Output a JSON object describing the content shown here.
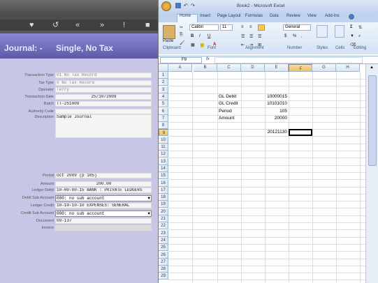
{
  "journal": {
    "header_title": "Journal: -",
    "header_subtitle": "Single, No Tax",
    "fields": [
      {
        "label": "Transaction Type",
        "value": "01 No Tax Record",
        "style": "grey"
      },
      {
        "label": "Tax Type",
        "value": "0 No Tax Record",
        "style": "grey"
      },
      {
        "label": "Operator",
        "value": "Terry",
        "style": "grey"
      },
      {
        "label": "Transaction Date",
        "value": "25/10/2009",
        "style": "normal"
      },
      {
        "label": "Batch",
        "value": "TT-251009",
        "style": "normal"
      },
      {
        "label": "Authority Code",
        "value": "",
        "style": "normal"
      },
      {
        "label": "Description",
        "value": "Sample Journal",
        "style": "normal"
      },
      {
        "label": "Period",
        "value": "Oct 2009 (p 105)",
        "style": "normal"
      },
      {
        "label": "Amount",
        "value": "200.00",
        "style": "normal"
      },
      {
        "label": "Ledger Debit",
        "value": "10-00-00-15 BANK : PRIVATE LEDGERS",
        "style": "normal"
      },
      {
        "label": "Debit Sub Account",
        "value": "000: no sub account",
        "style": "select"
      },
      {
        "label": "Ledger Credit",
        "value": "10-10-10-10 EXPENSES: GENERAL",
        "style": "normal"
      },
      {
        "label": "Credit Sub Account",
        "value": "000: no sub account",
        "style": "select"
      },
      {
        "label": "Document",
        "value": "09-137",
        "style": "normal"
      },
      {
        "label": "Invoice",
        "value": "",
        "style": "blank"
      }
    ]
  },
  "excel": {
    "title": "Book2 - Microsoft Excel",
    "tabs": [
      "Home",
      "Insert",
      "Page Layout",
      "Formulas",
      "Data",
      "Review",
      "View",
      "Add-Ins"
    ],
    "groups": [
      "Clipboard",
      "Font",
      "Alignment",
      "Number",
      "Styles",
      "Cells",
      "Editing"
    ],
    "paste_label": "Paste",
    "font_name": "Calibri",
    "font_size": "11",
    "number_format": "General",
    "name_box": "F9",
    "fx_label": "fx",
    "columns": [
      "A",
      "B",
      "C",
      "D",
      "E",
      "F",
      "G",
      "H"
    ],
    "rows": [
      "1",
      "2",
      "3",
      "4",
      "5",
      "6",
      "7",
      "8",
      "9",
      "10",
      "11",
      "12",
      "13",
      "14",
      "15",
      "16",
      "17",
      "18",
      "19",
      "20",
      "21",
      "22",
      "23",
      "24",
      "25",
      "26",
      "27",
      "28",
      "29"
    ],
    "selected_cell": "F9",
    "cells": [
      {
        "ref": "C4",
        "value": "GL Debit"
      },
      {
        "ref": "E4",
        "value": "10000015"
      },
      {
        "ref": "C5",
        "value": "GL Credit"
      },
      {
        "ref": "E5",
        "value": "10101010"
      },
      {
        "ref": "C6",
        "value": "Period"
      },
      {
        "ref": "E6",
        "value": "105"
      },
      {
        "ref": "C7",
        "value": "Amount"
      },
      {
        "ref": "E7",
        "value": "20000"
      },
      {
        "ref": "E9",
        "value": "20121130"
      }
    ]
  }
}
